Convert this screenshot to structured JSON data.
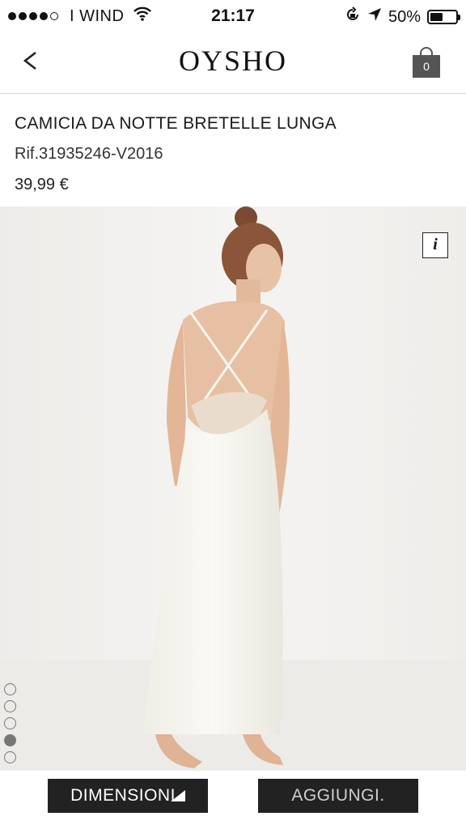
{
  "status_bar": {
    "carrier": "I WIND",
    "time": "21:17",
    "battery_percent": "50%",
    "battery_level": 0.5,
    "signal_bars": 4,
    "signal_total": 5
  },
  "nav": {
    "back_label": "<",
    "brand": "OYSHO",
    "cart_count": "0"
  },
  "product": {
    "name": "CAMICIA DA NOTTE BRETELLE LUNGA",
    "ref": "Rif.31935246-V2016",
    "price": "39,99 €",
    "info_label": "i"
  },
  "gallery": {
    "pages": 5,
    "active_page": 4
  },
  "actions": {
    "size_label": "DIMENSIONI",
    "add_label": "AGGIUNGI."
  },
  "colors": {
    "button_bg": "#222222",
    "image_bg": "#f3f1ee",
    "dress": "#f7f6f1"
  },
  "icons": {
    "wifi": "wifi-icon",
    "lock": "rotation-lock-icon",
    "location": "location-arrow-icon",
    "battery": "battery-icon",
    "back": "chevron-left-icon",
    "cart": "shopping-bag-icon",
    "info": "info-icon",
    "ruler": "ruler-icon"
  }
}
